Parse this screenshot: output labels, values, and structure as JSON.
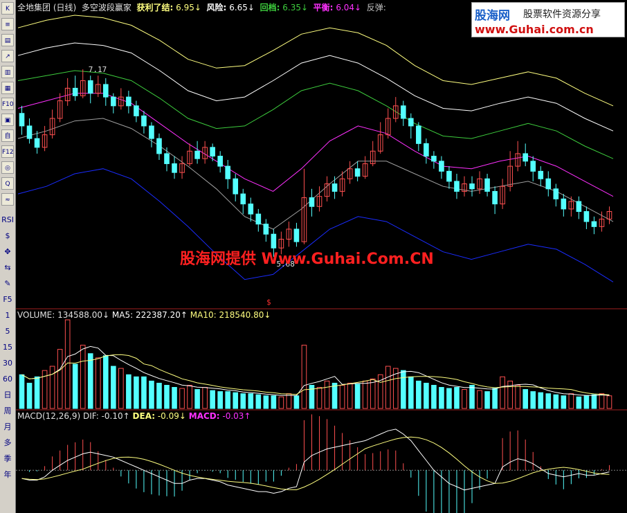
{
  "toolbar": {
    "buttons": [
      "K",
      "≡",
      "▤",
      "↗",
      "▥",
      "▦",
      "F10",
      "▣",
      "自",
      "F12",
      "◎",
      "Q",
      "≈"
    ],
    "text_items": [
      "RSI",
      "$",
      "✥",
      "⇆",
      "✎",
      "F5",
      "1",
      "5",
      "15",
      "30",
      "60",
      "日",
      "周",
      "月",
      "多",
      "季",
      "年"
    ]
  },
  "header": {
    "name": "全地集团 (日线)",
    "indicator": "多空波段赢家",
    "profit_label": "获利了结:",
    "profit_value": "6.95↓",
    "risk_label": "风险:",
    "risk_value": "6.65↓",
    "pullback_label": "回档:",
    "pullback_value": "6.35↓",
    "balance_label": "平衡:",
    "balance_value": "6.04↓",
    "rebound_label": "反弹:"
  },
  "volume_header": {
    "vol_label": "VOLUME:",
    "vol_value": "134588.00↓",
    "ma5_label": "MA5:",
    "ma5_value": "222387.20↑",
    "ma10_label": "MA10:",
    "ma10_value": "218540.80↓"
  },
  "macd_header": {
    "title": "MACD(12,26,9)",
    "dif_label": "DIF:",
    "dif_value": "-0.10↑",
    "dea_label": "DEA:",
    "dea_value": "-0.09↓",
    "macd_label": "MACD:",
    "macd_value": "-0.03↑"
  },
  "annotations": {
    "high": "7.17",
    "low": "5.68",
    "signal": "$"
  },
  "watermark": "股海网提供 Www.Guhai.Com.CN",
  "logo": {
    "brand": "股海网",
    "tagline": "股票软件资源分享",
    "url": "www.Guhai.com.cn"
  },
  "colors": {
    "up": "#ff5050",
    "down": "#54ffff",
    "yellow": "#ffff80",
    "green": "#3dcc3d",
    "magenta": "#ff30ff",
    "blue": "#1a2cff",
    "gray": "#a0a0a0",
    "white": "#ffffff"
  },
  "chart_data": {
    "type": "candlestick",
    "price_range": [
      5.3,
      7.6
    ],
    "candles": [
      [
        6.82,
        6.72,
        6.88,
        6.65
      ],
      [
        6.72,
        6.62,
        6.78,
        6.58
      ],
      [
        6.62,
        6.55,
        6.68,
        6.5
      ],
      [
        6.55,
        6.65,
        6.72,
        6.52
      ],
      [
        6.65,
        6.78,
        6.85,
        6.62
      ],
      [
        6.78,
        6.92,
        6.98,
        6.75
      ],
      [
        6.92,
        7.02,
        7.1,
        6.88
      ],
      [
        7.02,
        6.96,
        7.12,
        6.92
      ],
      [
        6.96,
        7.08,
        7.17,
        6.94
      ],
      [
        7.08,
        6.98,
        7.12,
        6.9
      ],
      [
        6.98,
        7.05,
        7.12,
        6.95
      ],
      [
        7.05,
        6.95,
        7.1,
        6.88
      ],
      [
        6.95,
        6.88,
        6.98,
        6.82
      ],
      [
        6.88,
        6.95,
        7.02,
        6.85
      ],
      [
        6.95,
        6.88,
        7.0,
        6.82
      ],
      [
        6.88,
        6.8,
        6.92,
        6.75
      ],
      [
        6.8,
        6.72,
        6.84,
        6.66
      ],
      [
        6.72,
        6.62,
        6.75,
        6.55
      ],
      [
        6.62,
        6.5,
        6.66,
        6.45
      ],
      [
        6.5,
        6.42,
        6.55,
        6.36
      ],
      [
        6.42,
        6.35,
        6.48,
        6.3
      ],
      [
        6.35,
        6.42,
        6.48,
        6.3
      ],
      [
        6.42,
        6.52,
        6.58,
        6.4
      ],
      [
        6.52,
        6.46,
        6.6,
        6.42
      ],
      [
        6.46,
        6.55,
        6.6,
        6.42
      ],
      [
        6.55,
        6.48,
        6.58,
        6.44
      ],
      [
        6.48,
        6.4,
        6.52,
        6.35
      ],
      [
        6.4,
        6.3,
        6.45,
        6.22
      ],
      [
        6.3,
        6.18,
        6.34,
        6.12
      ],
      [
        6.18,
        6.1,
        6.22,
        6.02
      ],
      [
        6.1,
        6.02,
        6.15,
        5.96
      ],
      [
        6.02,
        5.94,
        6.06,
        5.88
      ],
      [
        5.94,
        5.86,
        5.98,
        5.8
      ],
      [
        5.86,
        5.75,
        5.9,
        5.68
      ],
      [
        5.75,
        5.82,
        5.88,
        5.7
      ],
      [
        5.82,
        5.9,
        5.96,
        5.76
      ],
      [
        5.9,
        5.8,
        5.95,
        5.76
      ],
      [
        5.8,
        6.15,
        6.38,
        5.78
      ],
      [
        6.15,
        6.08,
        6.22,
        6.0
      ],
      [
        6.08,
        6.16,
        6.24,
        6.04
      ],
      [
        6.16,
        6.26,
        6.32,
        6.12
      ],
      [
        6.26,
        6.2,
        6.32,
        6.14
      ],
      [
        6.2,
        6.3,
        6.36,
        6.16
      ],
      [
        6.3,
        6.38,
        6.44,
        6.26
      ],
      [
        6.38,
        6.32,
        6.44,
        6.28
      ],
      [
        6.32,
        6.42,
        6.48,
        6.3
      ],
      [
        6.42,
        6.52,
        6.6,
        6.4
      ],
      [
        6.52,
        6.65,
        6.75,
        6.5
      ],
      [
        6.65,
        6.78,
        6.86,
        6.62
      ],
      [
        6.78,
        6.88,
        6.95,
        6.75
      ],
      [
        6.88,
        6.78,
        6.92,
        6.72
      ],
      [
        6.78,
        6.72,
        6.82,
        6.62
      ],
      [
        6.72,
        6.58,
        6.75,
        6.52
      ],
      [
        6.58,
        6.48,
        6.62,
        6.42
      ],
      [
        6.48,
        6.44,
        6.52,
        6.38
      ],
      [
        6.44,
        6.36,
        6.48,
        6.3
      ],
      [
        6.36,
        6.28,
        6.4,
        6.22
      ],
      [
        6.28,
        6.2,
        6.34,
        6.14
      ],
      [
        6.2,
        6.26,
        6.32,
        6.16
      ],
      [
        6.26,
        6.22,
        6.32,
        6.16
      ],
      [
        6.22,
        6.3,
        6.36,
        6.18
      ],
      [
        6.3,
        6.2,
        6.34,
        6.16
      ],
      [
        6.2,
        6.1,
        6.24,
        6.02
      ],
      [
        6.1,
        6.24,
        6.3,
        6.06
      ],
      [
        6.24,
        6.4,
        6.52,
        6.2
      ],
      [
        6.4,
        6.5,
        6.6,
        6.36
      ],
      [
        6.5,
        6.44,
        6.58,
        6.4
      ],
      [
        6.44,
        6.36,
        6.48,
        6.28
      ],
      [
        6.36,
        6.3,
        6.4,
        6.24
      ],
      [
        6.3,
        6.22,
        6.36,
        6.16
      ],
      [
        6.22,
        6.14,
        6.26,
        6.08
      ],
      [
        6.14,
        6.06,
        6.18,
        6.0
      ],
      [
        6.06,
        6.12,
        6.16,
        6.0
      ],
      [
        6.12,
        6.04,
        6.16,
        5.98
      ],
      [
        6.04,
        5.96,
        6.08,
        5.9
      ],
      [
        5.96,
        5.92,
        6.0,
        5.86
      ],
      [
        5.92,
        5.98,
        6.04,
        5.88
      ],
      [
        5.98,
        6.04,
        6.08,
        5.94
      ]
    ],
    "volume_range": [
      0,
      420000
    ],
    "volume": [
      160000,
      120000,
      150000,
      180000,
      200000,
      280000,
      420000,
      210000,
      300000,
      260000,
      240000,
      250000,
      200000,
      190000,
      160000,
      150000,
      150000,
      130000,
      120000,
      110000,
      100000,
      95000,
      110000,
      90000,
      100000,
      85000,
      80000,
      80000,
      75000,
      70000,
      70000,
      65000,
      60000,
      60000,
      55000,
      70000,
      60000,
      300000,
      110000,
      100000,
      130000,
      120000,
      110000,
      120000,
      115000,
      130000,
      140000,
      160000,
      200000,
      190000,
      180000,
      150000,
      130000,
      120000,
      110000,
      100000,
      95000,
      100000,
      90000,
      110000,
      85000,
      80000,
      95000,
      150000,
      130000,
      110000,
      90000,
      80000,
      75000,
      70000,
      65000,
      60000,
      70000,
      55000,
      60000,
      65000,
      70000,
      60000
    ],
    "macd_range": [
      -0.26,
      0.3
    ],
    "macd": [
      -0.05,
      -0.06,
      -0.06,
      -0.04,
      0.0,
      0.03,
      0.06,
      0.08,
      0.1,
      0.11,
      0.1,
      0.09,
      0.08,
      0.06,
      0.04,
      0.02,
      0.0,
      -0.02,
      -0.04,
      -0.06,
      -0.08,
      -0.08,
      -0.06,
      -0.05,
      -0.05,
      -0.06,
      -0.07,
      -0.09,
      -0.1,
      -0.11,
      -0.12,
      -0.13,
      -0.13,
      -0.14,
      -0.13,
      -0.11,
      -0.1,
      0.05,
      0.09,
      0.11,
      0.13,
      0.14,
      0.15,
      0.16,
      0.17,
      0.18,
      0.2,
      0.22,
      0.24,
      0.25,
      0.22,
      0.18,
      0.12,
      0.06,
      0.0,
      -0.04,
      -0.08,
      -0.1,
      -0.12,
      -0.11,
      -0.1,
      -0.09,
      -0.08,
      0.02,
      0.05,
      0.07,
      0.06,
      0.04,
      0.01,
      -0.02,
      -0.03,
      -0.04,
      -0.03,
      -0.02,
      -0.03,
      -0.03,
      -0.02,
      -0.01
    ],
    "bands": [
      {
        "name": "",
        "color": "#ffff80",
        "values": [
          7.5,
          7.56,
          7.6,
          7.58,
          7.52,
          7.4,
          7.25,
          7.18,
          7.2,
          7.32,
          7.45,
          7.5,
          7.46,
          7.36,
          7.2,
          7.08,
          7.05,
          7.1,
          7.15,
          7.1,
          6.98,
          6.88
        ]
      },
      {
        "name": "",
        "color": "#ffffff",
        "values": [
          7.28,
          7.34,
          7.38,
          7.36,
          7.3,
          7.16,
          7.0,
          6.92,
          6.95,
          7.08,
          7.22,
          7.28,
          7.22,
          7.1,
          6.96,
          6.86,
          6.84,
          6.9,
          6.95,
          6.9,
          6.78,
          6.68
        ]
      },
      {
        "name": "",
        "color": "#3dcc3d",
        "values": [
          7.08,
          7.12,
          7.16,
          7.14,
          7.08,
          6.94,
          6.78,
          6.7,
          6.72,
          6.85,
          7.0,
          7.06,
          7.0,
          6.88,
          6.74,
          6.64,
          6.62,
          6.68,
          6.74,
          6.68,
          6.56,
          6.46
        ]
      },
      {
        "name": "",
        "color": "#ff30ff",
        "values": [
          6.86,
          6.92,
          6.98,
          6.98,
          6.9,
          6.74,
          6.58,
          6.44,
          6.3,
          6.2,
          6.38,
          6.6,
          6.72,
          6.66,
          6.52,
          6.4,
          6.38,
          6.44,
          6.48,
          6.4,
          6.28,
          6.16
        ]
      },
      {
        "name": "",
        "color": "#a0a0a0",
        "values": [
          6.62,
          6.68,
          6.76,
          6.78,
          6.7,
          6.56,
          6.4,
          6.22,
          6.0,
          5.9,
          6.06,
          6.26,
          6.44,
          6.44,
          6.34,
          6.24,
          6.2,
          6.24,
          6.28,
          6.2,
          6.08,
          5.96
        ]
      },
      {
        "name": "",
        "color": "#1a2cff",
        "values": [
          6.18,
          6.24,
          6.34,
          6.38,
          6.3,
          6.12,
          5.92,
          5.7,
          5.5,
          5.54,
          5.72,
          5.9,
          6.0,
          5.96,
          5.84,
          5.72,
          5.66,
          5.72,
          5.78,
          5.74,
          5.62,
          5.48
        ]
      }
    ]
  }
}
